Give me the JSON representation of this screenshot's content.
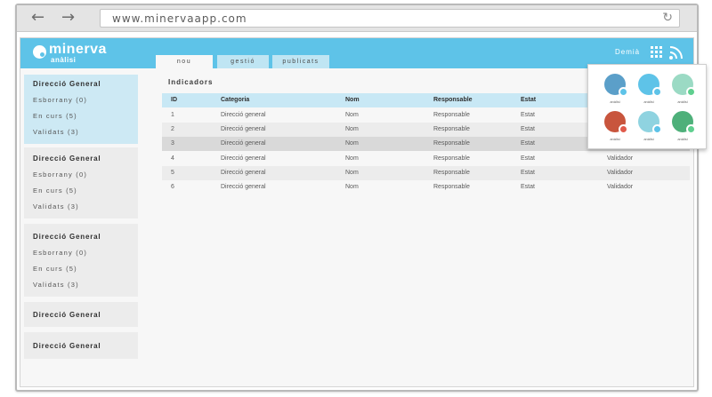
{
  "browser": {
    "url": "www.minervaapp.com",
    "back_icon": "arrow-left-icon",
    "forward_icon": "arrow-right-icon",
    "reload_icon": "reload-icon"
  },
  "header": {
    "logo_name": "minerva",
    "logo_sub": "anàlisi",
    "tabs": [
      "nou",
      "gestió",
      "publicats"
    ],
    "user_name": "Demià",
    "accent_color": "#5ec3e8"
  },
  "sidebar": {
    "groups": [
      {
        "title": "Direcció General",
        "items": [
          "Esborrany (0)",
          "En curs (5)",
          "Validats (3)"
        ]
      },
      {
        "title": "Direcció General",
        "items": [
          "Esborrany (0)",
          "En curs (5)",
          "Validats (3)"
        ]
      },
      {
        "title": "Direcció General",
        "items": [
          "Esborrany (0)",
          "En curs (5)",
          "Validats (3)"
        ]
      },
      {
        "title": "Direcció General",
        "items": []
      },
      {
        "title": "Direcció General",
        "items": []
      }
    ]
  },
  "main": {
    "title": "Indicadors",
    "columns": [
      "ID",
      "Categoria",
      "Nom",
      "Responsable",
      "Estat"
    ],
    "rows": [
      {
        "id": "1",
        "categoria": "Direcció general",
        "nom": "Nom",
        "responsable": "Responsable",
        "estat": "Estat",
        "validador": ""
      },
      {
        "id": "2",
        "categoria": "Direcció general",
        "nom": "Nom",
        "responsable": "Responsable",
        "estat": "Estat",
        "validador": ""
      },
      {
        "id": "3",
        "categoria": "Direcció general",
        "nom": "Nom",
        "responsable": "Responsable",
        "estat": "Estat",
        "validador": ""
      },
      {
        "id": "4",
        "categoria": "Direcció general",
        "nom": "Nom",
        "responsable": "Responsable",
        "estat": "Estat",
        "validador": "Validador"
      },
      {
        "id": "5",
        "categoria": "Direcció general",
        "nom": "Nom",
        "responsable": "Responsable",
        "estat": "Estat",
        "validador": "Validador"
      },
      {
        "id": "6",
        "categoria": "Direcció general",
        "nom": "Nom",
        "responsable": "Responsable",
        "estat": "Estat",
        "validador": "Validador"
      }
    ]
  },
  "launcher": {
    "apps": [
      {
        "label": "anàlisi",
        "color": "#5b9fc9",
        "badge": "#5ec3e8"
      },
      {
        "label": "anàlisi",
        "color": "#5ec3e8",
        "badge": "#5ec3e8"
      },
      {
        "label": "anàlisi",
        "color": "#9bdac4",
        "badge": "#5fcf8f"
      },
      {
        "label": "anàlisi",
        "color": "#c8553d",
        "badge": "#e05a4b"
      },
      {
        "label": "anàlisi",
        "color": "#8fd3e0",
        "badge": "#5ec3e8"
      },
      {
        "label": "anàlisi",
        "color": "#4eb07a",
        "badge": "#5fcf8f"
      }
    ]
  }
}
